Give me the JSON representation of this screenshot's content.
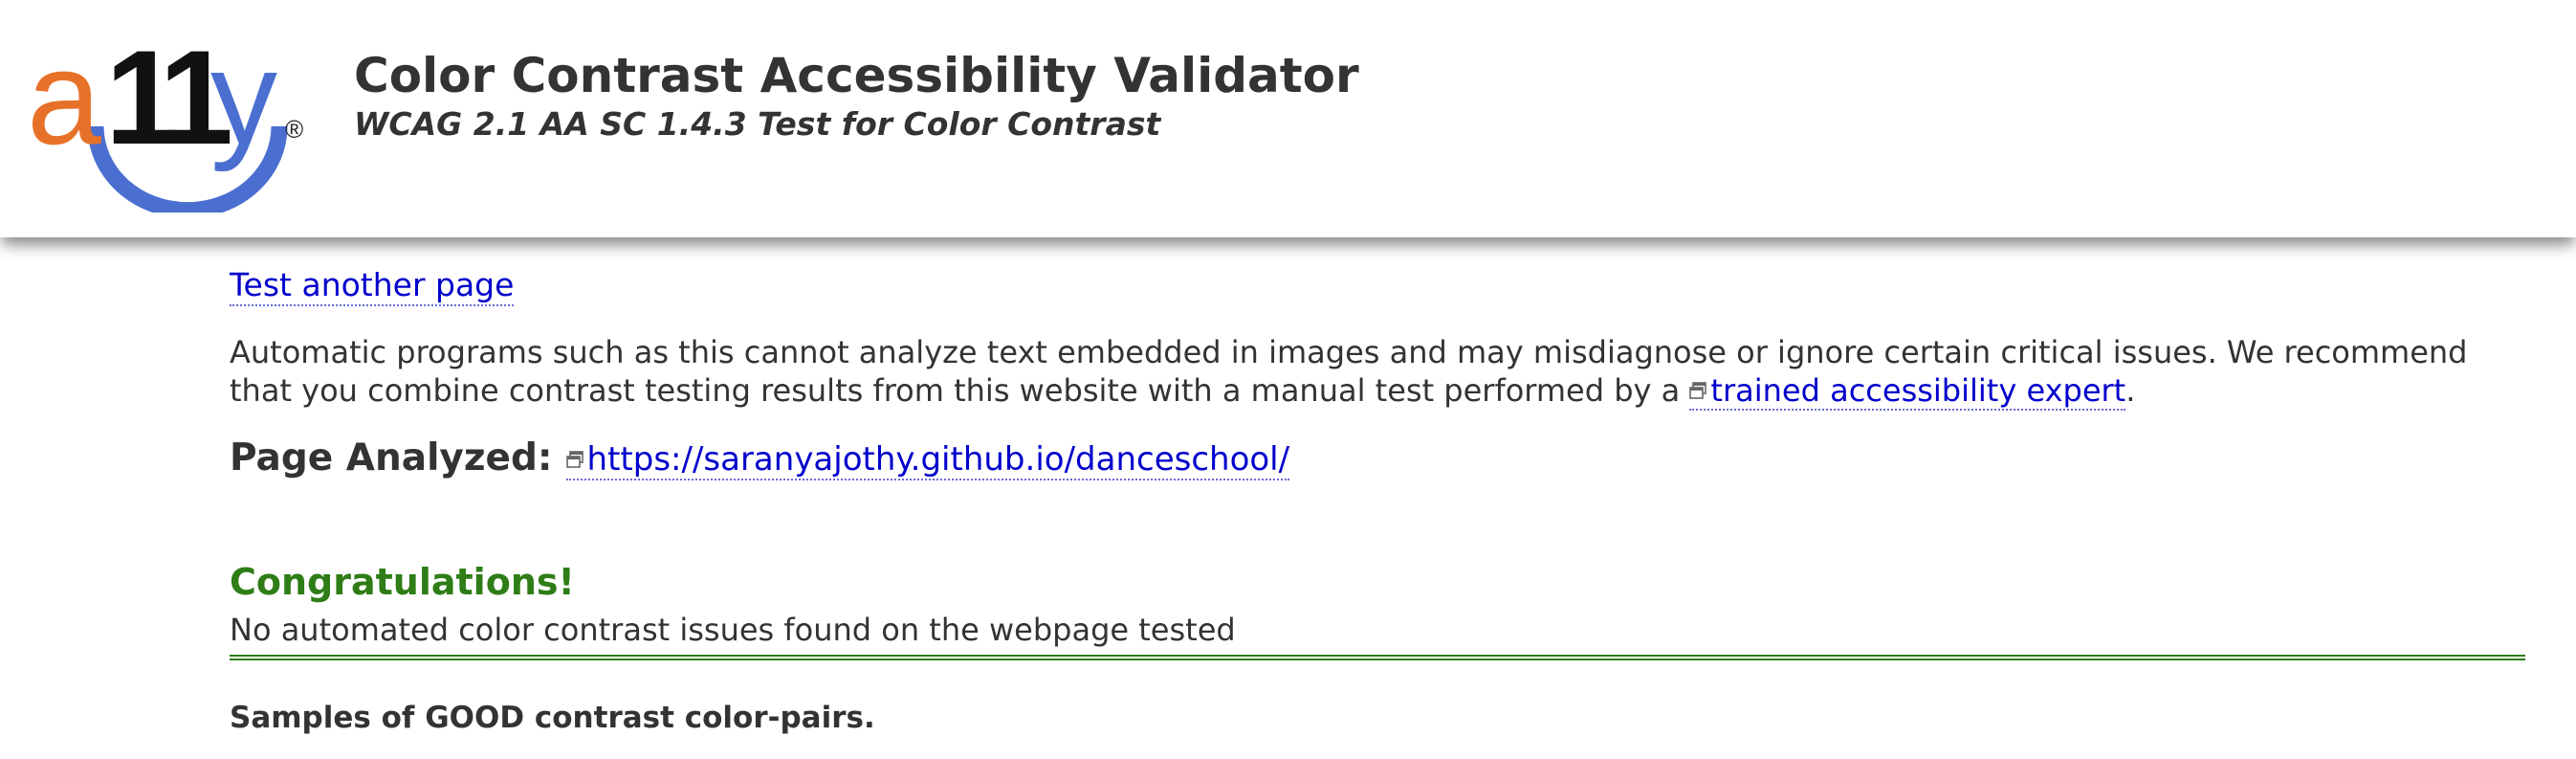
{
  "header": {
    "logo": {
      "text_a": "a",
      "text_11": "11",
      "text_y": "y",
      "registered": "®",
      "colors": {
        "a": "#e8712a",
        "eleven": "#111111",
        "y": "#4a6fd0",
        "arc": "#4a6fd0"
      }
    },
    "title": "Color Contrast Accessibility Validator",
    "subtitle": "WCAG 2.1 AA SC 1.4.3 Test for Color Contrast"
  },
  "main": {
    "test_another_page": "Test another page",
    "notice_text": "Automatic programs such as this cannot analyze text embedded in images and may misdiagnose or ignore certain critical issues. We recommend that you combine contrast testing results from this website with a manual test performed by a ",
    "notice_link": "trained accessibility expert",
    "notice_end": ".",
    "page_analyzed_label": "Page Analyzed:",
    "page_analyzed_url": "https://saranyajothy.github.io/danceschool/",
    "congrats_title": "Congratulations!",
    "congrats_text": "No automated color contrast issues found on the webpage tested",
    "samples_heading": "Samples of GOOD contrast color-pairs."
  },
  "colors": {
    "link": "#0000cc",
    "success": "#2e7d16",
    "text": "#333333"
  },
  "icons": [
    "a11y-logo",
    "external-window-icon"
  ]
}
